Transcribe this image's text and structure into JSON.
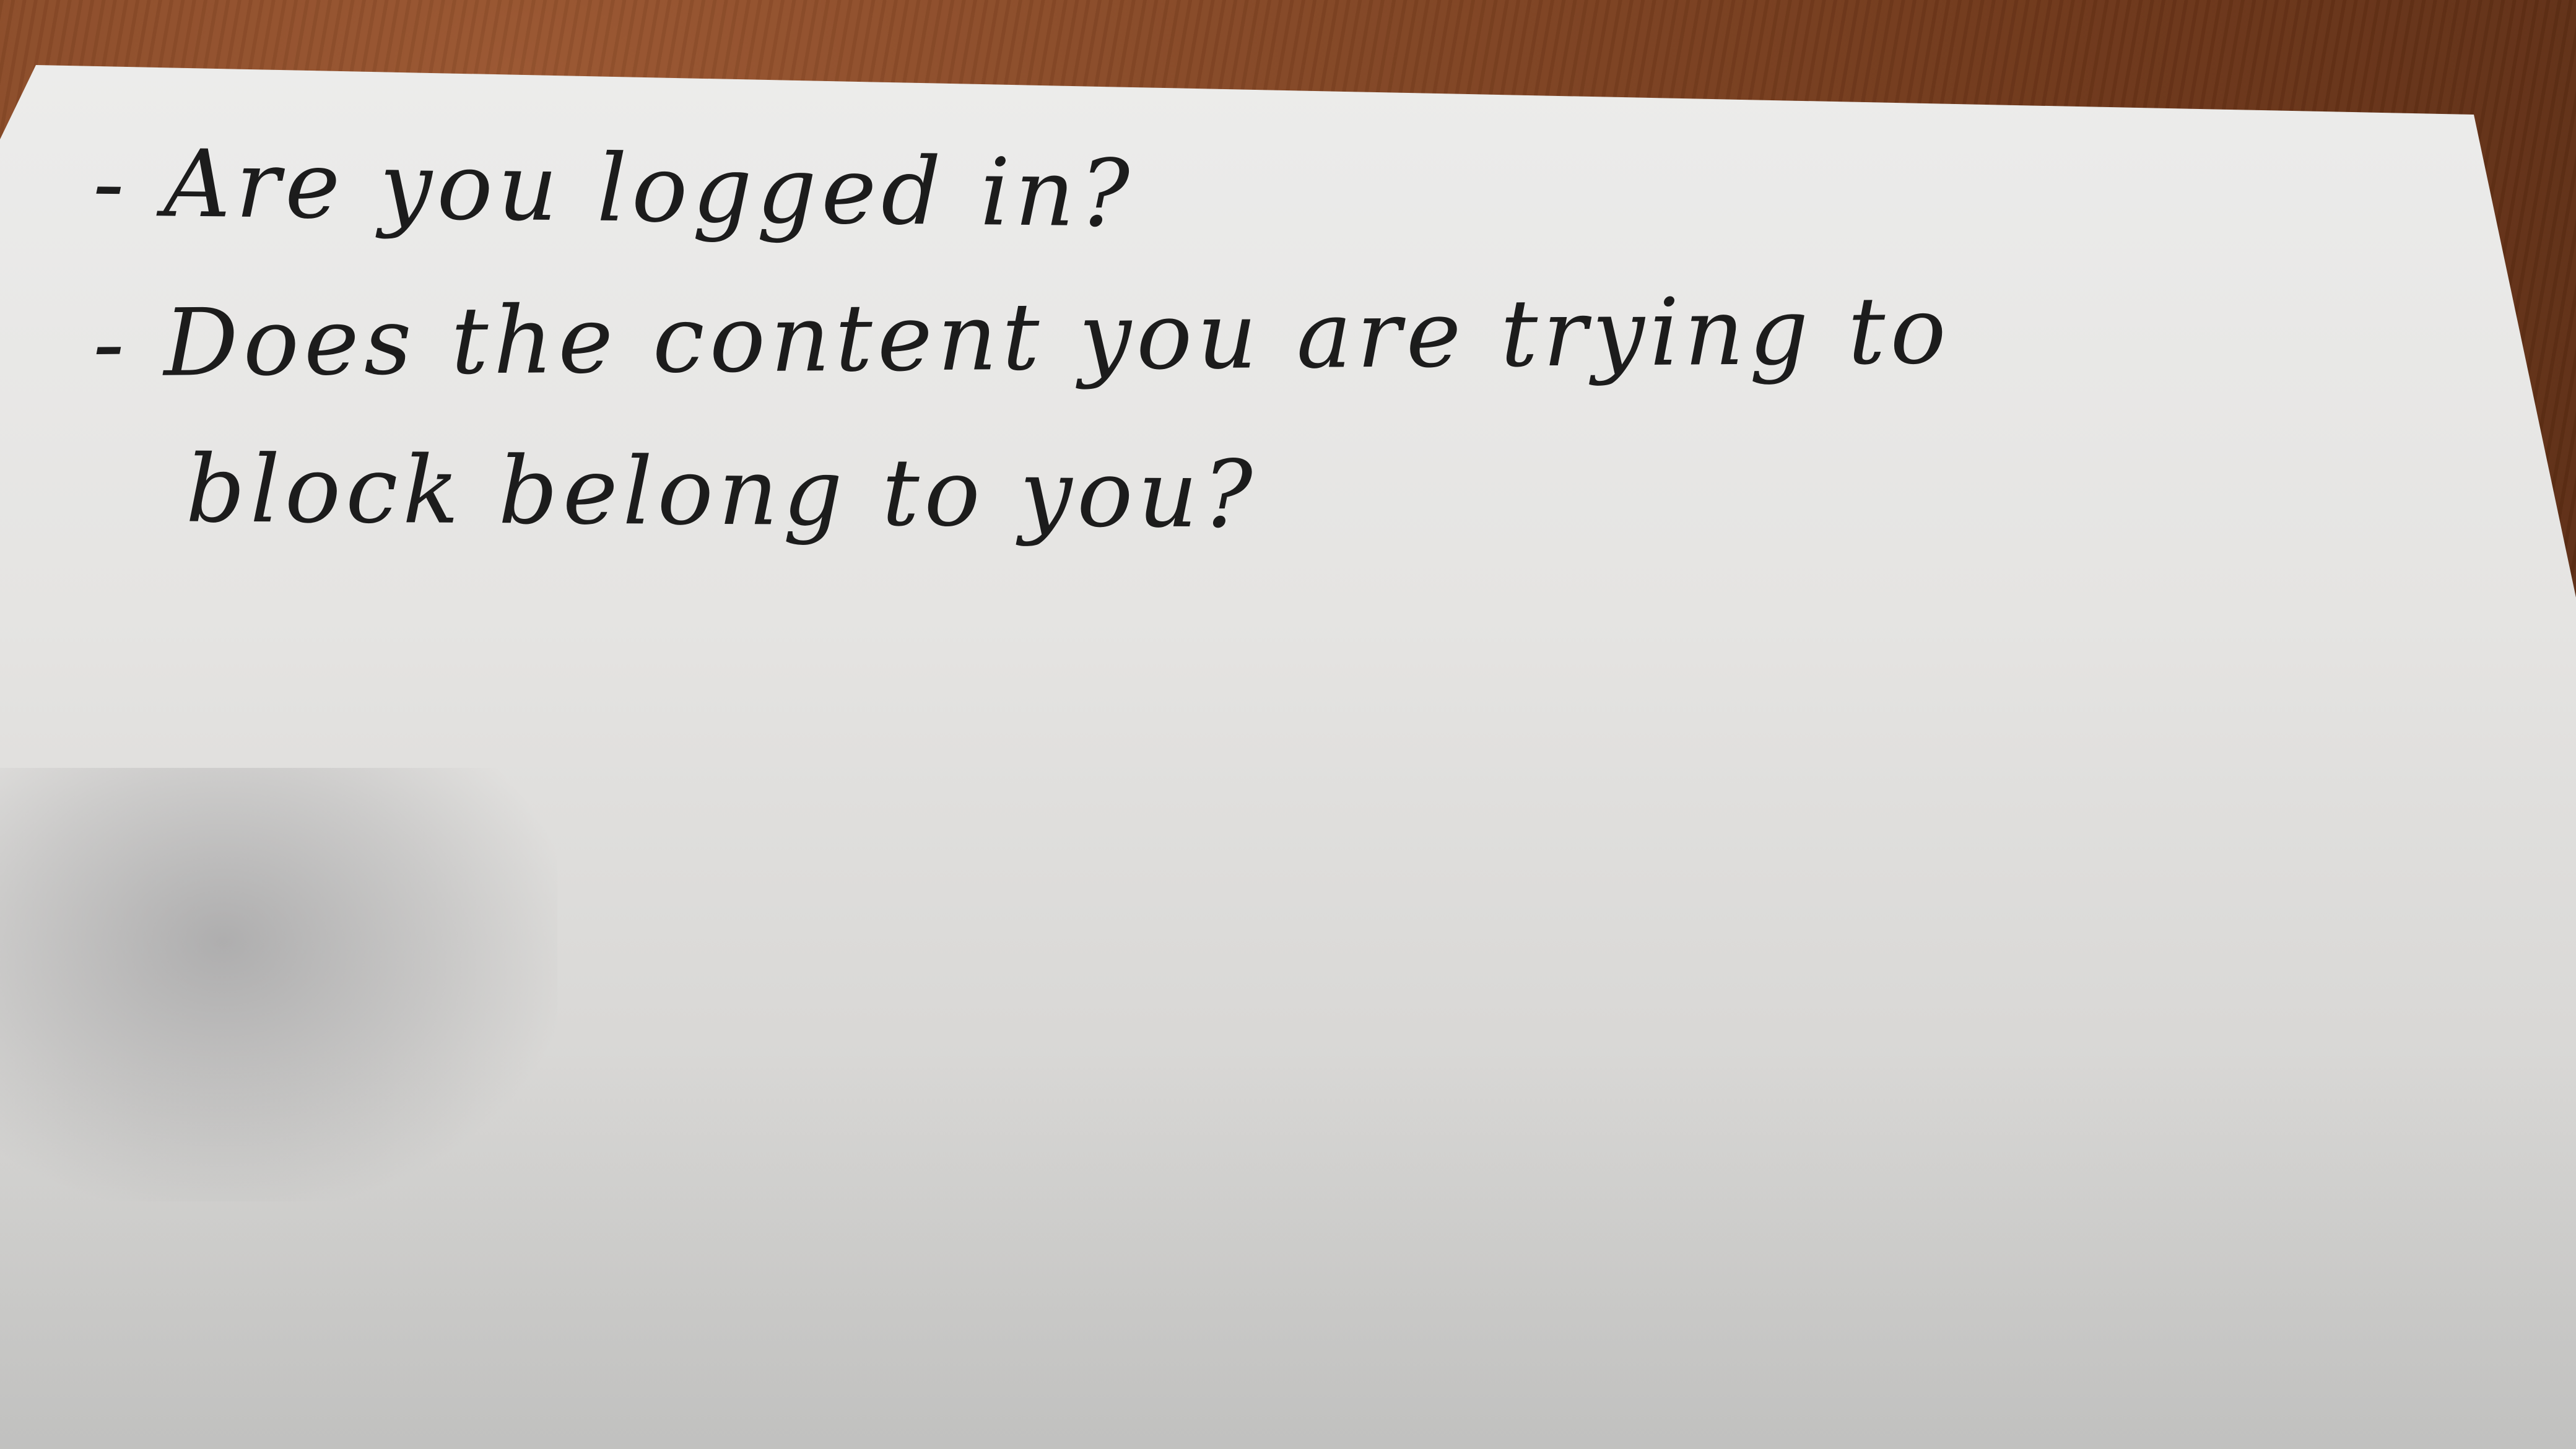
{
  "photo": {
    "subject": "handwritten-index-card",
    "colors": {
      "card": "#e6e5e3",
      "ink": "#1c1c1c",
      "table": "#6b3518"
    }
  },
  "note": {
    "lines": [
      "- Are you logged in?",
      "- Does the content you are trying to",
      "block belong to you?"
    ]
  }
}
